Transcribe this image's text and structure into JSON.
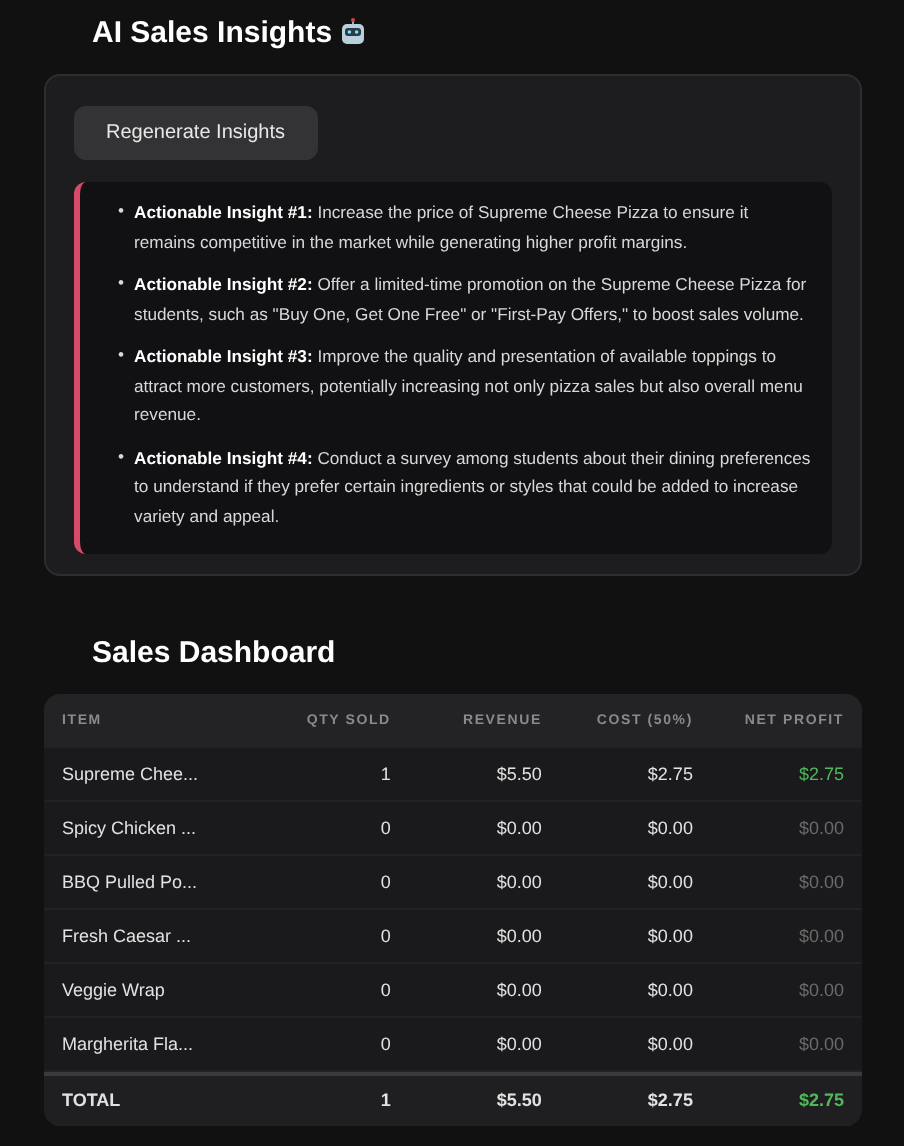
{
  "insights_title": "AI Sales Insights",
  "regenerate_button": "Regenerate Insights",
  "insights": [
    {
      "marker": "•",
      "label": "Actionable Insight #1:",
      "text": "Increase the price of Supreme Cheese Pizza to ensure it remains competitive in the market while generating higher profit margins."
    },
    {
      "marker": "•",
      "label": "Actionable Insight #2:",
      "text": "Offer a limited-time promotion on the Supreme Cheese Pizza for students, such as \"Buy One, Get One Free\" or \"First-Pay Offers,\" to boost sales volume."
    },
    {
      "marker": "•",
      "label": "Actionable Insight #3:",
      "text": "Improve the quality and presentation of available toppings to attract more customers, potentially increasing not only pizza sales but also overall menu revenue."
    },
    {
      "marker": "•",
      "label": "Actionable Insight #4:",
      "text": "Conduct a survey among students about their dining preferences to understand if they prefer certain ingredients or styles that could be added to increase variety and appeal."
    }
  ],
  "dashboard_title": "Sales Dashboard",
  "table": {
    "columns": [
      "ITEM",
      "QTY SOLD",
      "REVENUE",
      "COST (50%)",
      "NET PROFIT"
    ],
    "rows": [
      {
        "item": "Supreme Chee...",
        "qty": "1",
        "revenue": "$5.50",
        "cost": "$2.75",
        "profit": "$2.75",
        "positive": true
      },
      {
        "item": "Spicy Chicken ...",
        "qty": "0",
        "revenue": "$0.00",
        "cost": "$0.00",
        "profit": "$0.00",
        "positive": false
      },
      {
        "item": "BBQ Pulled Po...",
        "qty": "0",
        "revenue": "$0.00",
        "cost": "$0.00",
        "profit": "$0.00",
        "positive": false
      },
      {
        "item": "Fresh Caesar ...",
        "qty": "0",
        "revenue": "$0.00",
        "cost": "$0.00",
        "profit": "$0.00",
        "positive": false
      },
      {
        "item": "Veggie Wrap",
        "qty": "0",
        "revenue": "$0.00",
        "cost": "$0.00",
        "profit": "$0.00",
        "positive": false
      },
      {
        "item": "Margherita Fla...",
        "qty": "0",
        "revenue": "$0.00",
        "cost": "$0.00",
        "profit": "$0.00",
        "positive": false
      }
    ],
    "total": {
      "item": "TOTAL",
      "qty": "1",
      "revenue": "$5.50",
      "cost": "$2.75",
      "profit": "$2.75",
      "positive": true
    }
  }
}
